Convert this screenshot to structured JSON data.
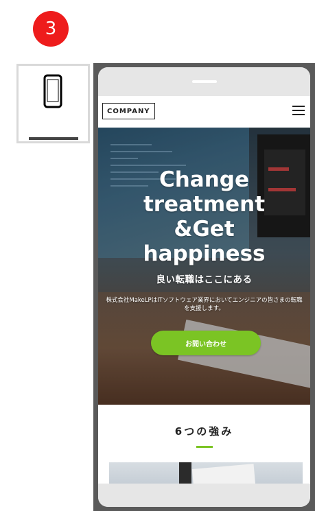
{
  "step": {
    "number": "3"
  },
  "device_toggle": {
    "selected": "mobile",
    "icon": "smartphone-icon"
  },
  "preview": {
    "header": {
      "logo": "COMPANY",
      "menu_icon": "hamburger-menu-icon"
    },
    "hero": {
      "title_lines": [
        "Change",
        "treatment",
        "&Get",
        "happiness"
      ],
      "subtitle": "良い転職はここにある",
      "description": "株式会社MakeLPはITソフトウェア業界においてエンジニアの皆さまの転職を支援します。",
      "cta_label": "お問い合わせ"
    },
    "section": {
      "title": "6つの強み"
    }
  },
  "colors": {
    "badge": "#ee1c1c",
    "accent": "#7bc424",
    "frame": "#5a5a5a"
  }
}
